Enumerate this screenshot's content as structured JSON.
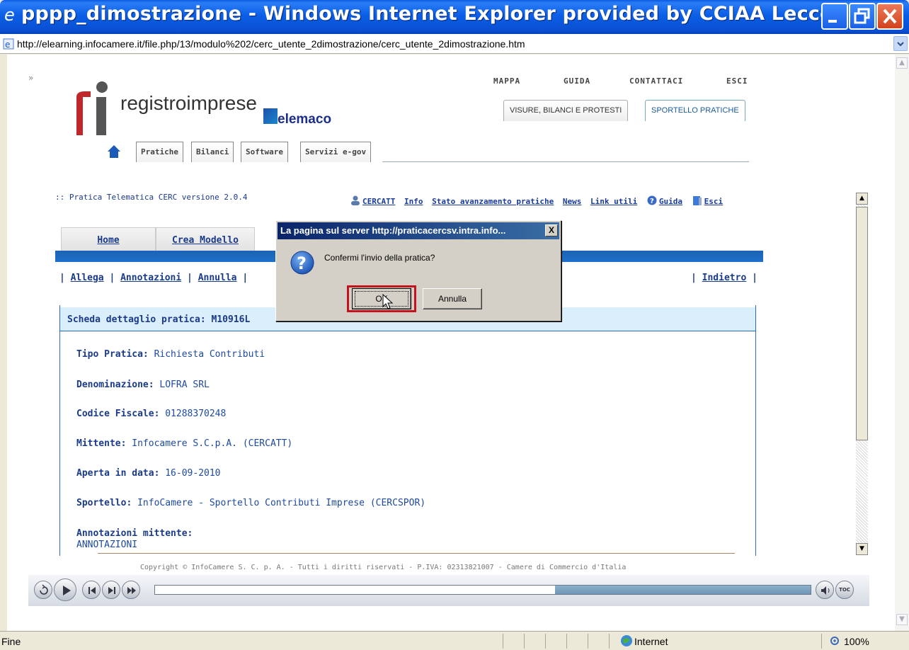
{
  "window": {
    "title": "pppp_dimostrazione - Windows Internet Explorer provided by CCIAA Lecce",
    "address": "http://elearning.infocamere.it/file.php/13/modulo%202/cerc_utente_2dimostrazione/cerc_utente_2dimostrazione.htm"
  },
  "chevrons": "»",
  "top_links": [
    "MAPPA",
    "GUIDA",
    "CONTATTACI",
    "ESCI"
  ],
  "logo": {
    "brand": "registroimprese",
    "sub": "elemaco"
  },
  "category_tabs": [
    "VISURE, BILANCI E PROTESTI",
    "SPORTELLO PRATICHE"
  ],
  "nav_tabs": [
    "Pratiche",
    "Bilanci",
    "Software",
    "Servizi e-gov"
  ],
  "version_text": ":: Pratica Telematica CERC versione 2.0.4",
  "tool_links": {
    "cercatt": "CERCATT",
    "info": "Info",
    "stato": "Stato avanzamento pratiche",
    "news": "News",
    "link_utili": "Link utili",
    "guida": "Guida",
    "esci": "Esci"
  },
  "inner_tabs": [
    "Home",
    "Crea Modello"
  ],
  "actions": {
    "allega": "Allega",
    "annotazioni": "Annotazioni",
    "annulla": "Annulla",
    "sep": "|",
    "indietro": "Indietro"
  },
  "detail": {
    "title": "Scheda dettaglio pratica: M10916L",
    "fields": [
      {
        "label": "Tipo Pratica:",
        "value": "Richiesta Contributi"
      },
      {
        "label": "Denominazione:",
        "value": "LOFRA SRL"
      },
      {
        "label": "Codice Fiscale:",
        "value": "01288370248"
      },
      {
        "label": "Mittente:",
        "value": "Infocamere S.C.p.A. (CERCATT)"
      },
      {
        "label": "Aperta in data:",
        "value": "16-09-2010"
      },
      {
        "label": "Sportello:",
        "value": "InfoCamere - Sportello Contributi Imprese (CERCSPOR)"
      }
    ],
    "annot_label": "Annotazioni mittente:",
    "annot_value": "ANNOTAZIONI"
  },
  "copyright": "Copyright © InfoCamere S. C. p. A. - Tutti i diritti riservati - P.IVA: 02313821007 - Camere di Commercio d'Italia",
  "player": {
    "progress": 0.61,
    "toc": "TOC"
  },
  "status": {
    "text": "Fine",
    "zone": "Internet",
    "zoom": "100%"
  },
  "dialog": {
    "title": "La pagina sul server http://praticacercsv.intra.info...",
    "close": "X",
    "message": "Confermi l'invio della pratica?",
    "ok": "OK",
    "cancel": "Annulla"
  }
}
